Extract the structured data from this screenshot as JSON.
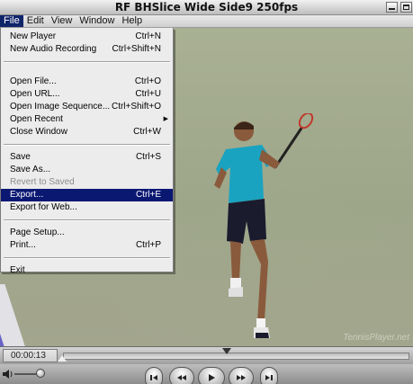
{
  "window": {
    "title": "RF BHSlice Wide Side9 250fps"
  },
  "menubar": {
    "items": [
      {
        "label": "File",
        "active": true
      },
      {
        "label": "Edit"
      },
      {
        "label": "View"
      },
      {
        "label": "Window"
      },
      {
        "label": "Help"
      }
    ]
  },
  "file_menu": {
    "new_player": {
      "label": "New Player",
      "shortcut": "Ctrl+N"
    },
    "new_audio": {
      "label": "New Audio Recording",
      "shortcut": "Ctrl+Shift+N"
    },
    "open_file": {
      "label": "Open File...",
      "shortcut": "Ctrl+O"
    },
    "open_url": {
      "label": "Open URL...",
      "shortcut": "Ctrl+U"
    },
    "open_seq": {
      "label": "Open Image Sequence...",
      "shortcut": "Ctrl+Shift+O"
    },
    "open_recent": {
      "label": "Open Recent"
    },
    "close_window": {
      "label": "Close Window",
      "shortcut": "Ctrl+W"
    },
    "save": {
      "label": "Save",
      "shortcut": "Ctrl+S"
    },
    "save_as": {
      "label": "Save As..."
    },
    "revert": {
      "label": "Revert to Saved"
    },
    "export": {
      "label": "Export...",
      "shortcut": "Ctrl+E"
    },
    "export_web": {
      "label": "Export for Web..."
    },
    "page_setup": {
      "label": "Page Setup..."
    },
    "print": {
      "label": "Print...",
      "shortcut": "Ctrl+P"
    },
    "exit": {
      "label": "Exit"
    }
  },
  "video": {
    "watermark": "TennisPlayer.net"
  },
  "timeline": {
    "current_time": "00:00:13"
  },
  "colors": {
    "menu_highlight": "#0a1872",
    "menubar_active": "#10246a"
  },
  "icons": {
    "volume": "speaker-icon",
    "rewind": "rewind-icon",
    "back": "step-back-icon",
    "play": "play-icon",
    "forward": "step-forward-icon"
  }
}
